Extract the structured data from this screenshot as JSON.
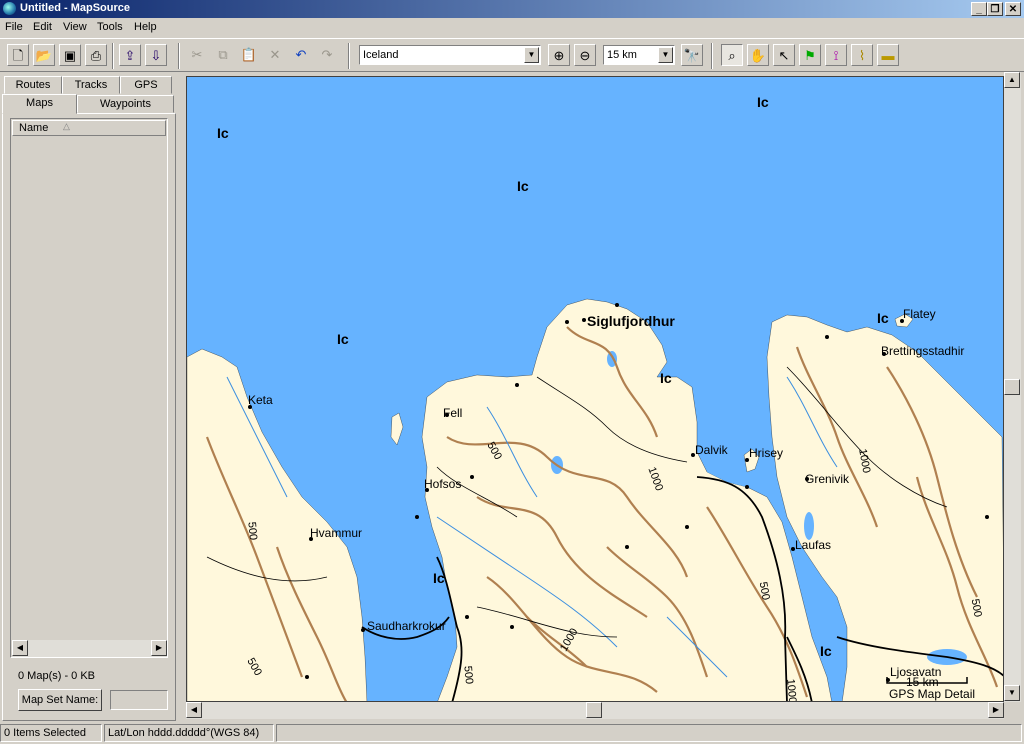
{
  "window": {
    "title": "Untitled - MapSource",
    "controls": {
      "minimize": "_",
      "maximize": "❐",
      "close": "✕"
    }
  },
  "menu": [
    "File",
    "Edit",
    "View",
    "Tools",
    "Help"
  ],
  "toolbar": {
    "region_value": "Iceland",
    "zoom_value": "15 km",
    "icons": [
      "new-icon",
      "open-icon",
      "save-icon",
      "print-icon",
      "receive-from-device-icon",
      "send-to-device-icon",
      "cut-icon",
      "copy-icon",
      "paste-icon",
      "delete-icon",
      "undo-icon",
      "redo-icon",
      "zoom-in-icon",
      "zoom-out-icon",
      "find-icon",
      "zoom-tool-icon",
      "hand-tool-icon",
      "select-tool-icon",
      "waypoint-tool-icon",
      "route-tool-icon",
      "track-tool-icon",
      "distance-tool-icon"
    ]
  },
  "left_panel": {
    "tabs_row1": [
      "Routes",
      "Tracks",
      "GPS"
    ],
    "tabs_row2": [
      "Maps",
      "Waypoints"
    ],
    "active_tab": "Maps",
    "list_column": "Name",
    "maps_summary": "0 Map(s) - 0 KB",
    "map_set_button": "Map Set Name:",
    "map_set_value": ""
  },
  "map": {
    "water_color": "#66b3ff",
    "land_color": "#fff8dc",
    "contour_color": "#b08050",
    "places": [
      {
        "name": "Siglufjordhur",
        "major": true
      },
      {
        "name": "Flatey"
      },
      {
        "name": "Brettingsstadhir"
      },
      {
        "name": "Keta"
      },
      {
        "name": "Fell"
      },
      {
        "name": "Dalvik"
      },
      {
        "name": "Hrisey"
      },
      {
        "name": "Grenivik"
      },
      {
        "name": "Hofsos"
      },
      {
        "name": "Hvammur"
      },
      {
        "name": "Laufas"
      },
      {
        "name": "Saudharkrokur"
      },
      {
        "name": "Ljosavatn"
      }
    ],
    "ice_labels": [
      "Ic",
      "Ic",
      "Ic",
      "Ic",
      "Ic",
      "Ic",
      "Ic",
      "Ic"
    ],
    "contour_labels": [
      "500",
      "1000",
      "1000",
      "500",
      "500",
      "500",
      "1000",
      "500",
      "500",
      "1000"
    ],
    "scale_label": "15 km",
    "detail_label": "GPS Map Detail"
  },
  "status": {
    "selection": "0 Items Selected",
    "position_format": "Lat/Lon hddd.ddddd°(WGS 84)"
  }
}
